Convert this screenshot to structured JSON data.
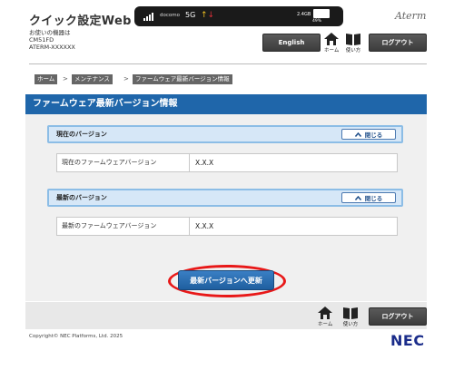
{
  "header": {
    "app_title": "クイック設定Web",
    "device_label": "お使いの機器は",
    "device_model": "CM51FD",
    "device_id": "ATERM-XXXXXX",
    "brand": "Aterm",
    "english_label": "English",
    "home_label": "ホーム",
    "manual_label": "使い方",
    "logout_label": "ログアウト"
  },
  "status_bar": {
    "carrier": "docomo",
    "network": "5G",
    "data_usage": "2.4GB",
    "battery": "49%"
  },
  "breadcrumb": {
    "items": [
      "ホーム",
      "メンテナンス",
      "ファームウェア最新バージョン情報"
    ],
    "separator": ">"
  },
  "page": {
    "title": "ファームウェア最新バージョン情報"
  },
  "sections": {
    "current": {
      "title": "現在のバージョン",
      "close_label": "閉じる",
      "row_label": "現在のファームウェアバージョン",
      "row_value": "X.X.X"
    },
    "latest": {
      "title": "最新のバージョン",
      "close_label": "閉じる",
      "row_label": "最新のファームウェアバージョン",
      "row_value": "X.X.X"
    }
  },
  "update_button_label": "最新バージョンへ更新",
  "footer": {
    "home_label": "ホーム",
    "manual_label": "使い方",
    "logout_label": "ログアウト",
    "copyright": "Copyright© NEC Platforms, Ltd. 2025",
    "logo": "NEC"
  },
  "colors": {
    "title_bar": "#1f66aa",
    "section_header": "#d6e7f7",
    "highlight_ring": "#e81818",
    "button_dark": "#4a4a4a",
    "nec_logo": "#1a2c8a"
  }
}
